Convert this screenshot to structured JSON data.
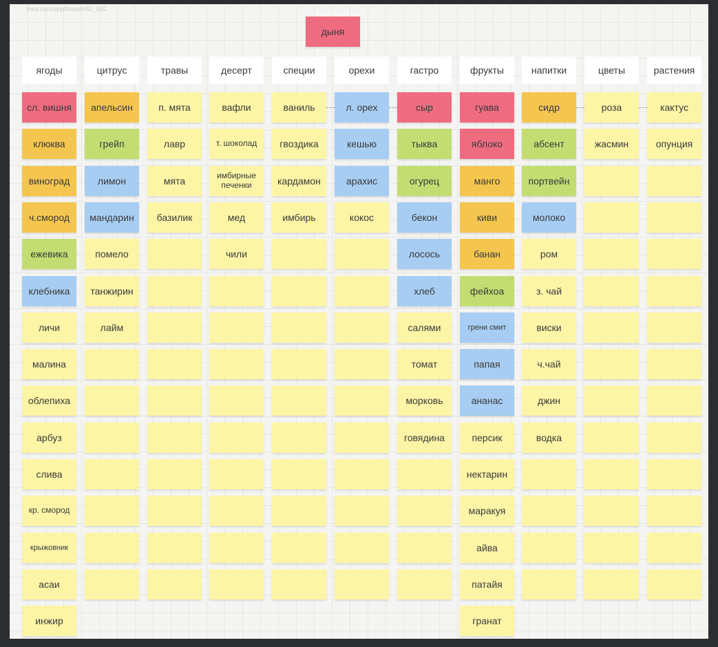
{
  "board": {
    "url_fragment": "miro.com/app/board/o9J_lSG"
  },
  "top_note": {
    "label": "дыня",
    "color": "red"
  },
  "colors": {
    "yellow": "#fdf5a6",
    "red": "#ef6b80",
    "orange": "#f4c64f",
    "green": "#c3dd72",
    "blue": "#a7cdf2"
  },
  "columns": [
    {
      "header": "ягоды",
      "notes": [
        {
          "text": "сл. вишня",
          "color": "red"
        },
        {
          "text": "клюква",
          "color": "orange"
        },
        {
          "text": "виноград",
          "color": "orange"
        },
        {
          "text": "ч.смород",
          "color": "orange"
        },
        {
          "text": "ежевика",
          "color": "green"
        },
        {
          "text": "клебника",
          "color": "blue"
        },
        {
          "text": "личи",
          "color": "yellow"
        },
        {
          "text": "малина",
          "color": "yellow"
        },
        {
          "text": "облепиха",
          "color": "yellow"
        },
        {
          "text": "арбуз",
          "color": "yellow"
        },
        {
          "text": "слива",
          "color": "yellow"
        },
        {
          "text": "кр. смород",
          "color": "yellow",
          "size": "small"
        },
        {
          "text": "крыжовник",
          "color": "yellow",
          "size": "tiny"
        },
        {
          "text": "асаи",
          "color": "yellow"
        },
        {
          "text": "инжир",
          "color": "yellow"
        }
      ]
    },
    {
      "header": "цитрус",
      "notes": [
        {
          "text": "апельсин",
          "color": "orange"
        },
        {
          "text": "грейп",
          "color": "green"
        },
        {
          "text": "лимон",
          "color": "blue"
        },
        {
          "text": "мандарин",
          "color": "blue"
        },
        {
          "text": "помело",
          "color": "yellow"
        },
        {
          "text": "танжирин",
          "color": "yellow"
        },
        {
          "text": "лайм",
          "color": "yellow"
        },
        {
          "text": "",
          "color": "yellow"
        },
        {
          "text": "",
          "color": "yellow"
        },
        {
          "text": "",
          "color": "yellow"
        },
        {
          "text": "",
          "color": "yellow"
        },
        {
          "text": "",
          "color": "yellow"
        },
        {
          "text": "",
          "color": "yellow"
        },
        {
          "text": "",
          "color": "yellow"
        }
      ]
    },
    {
      "header": "травы",
      "notes": [
        {
          "text": "п. мята",
          "color": "yellow"
        },
        {
          "text": "лавр",
          "color": "yellow"
        },
        {
          "text": "мята",
          "color": "yellow"
        },
        {
          "text": "базилик",
          "color": "yellow"
        },
        {
          "text": "",
          "color": "yellow"
        },
        {
          "text": "",
          "color": "yellow"
        },
        {
          "text": "",
          "color": "yellow"
        },
        {
          "text": "",
          "color": "yellow"
        },
        {
          "text": "",
          "color": "yellow"
        },
        {
          "text": "",
          "color": "yellow"
        },
        {
          "text": "",
          "color": "yellow"
        },
        {
          "text": "",
          "color": "yellow"
        },
        {
          "text": "",
          "color": "yellow"
        },
        {
          "text": "",
          "color": "yellow"
        }
      ]
    },
    {
      "header": "десерт",
      "notes": [
        {
          "text": "вафли",
          "color": "yellow"
        },
        {
          "text": "т. шоколад",
          "color": "yellow",
          "size": "small"
        },
        {
          "text": "имбирные печенки",
          "color": "yellow",
          "size": "small"
        },
        {
          "text": "мед",
          "color": "yellow"
        },
        {
          "text": "чили",
          "color": "yellow"
        },
        {
          "text": "",
          "color": "yellow"
        },
        {
          "text": "",
          "color": "yellow"
        },
        {
          "text": "",
          "color": "yellow"
        },
        {
          "text": "",
          "color": "yellow"
        },
        {
          "text": "",
          "color": "yellow"
        },
        {
          "text": "",
          "color": "yellow"
        },
        {
          "text": "",
          "color": "yellow"
        },
        {
          "text": "",
          "color": "yellow"
        },
        {
          "text": "",
          "color": "yellow"
        }
      ]
    },
    {
      "header": "специи",
      "notes": [
        {
          "text": "ваниль",
          "color": "yellow"
        },
        {
          "text": "гвоздика",
          "color": "yellow"
        },
        {
          "text": "кардамон",
          "color": "yellow"
        },
        {
          "text": "имбирь",
          "color": "yellow"
        },
        {
          "text": "",
          "color": "yellow"
        },
        {
          "text": "",
          "color": "yellow"
        },
        {
          "text": "",
          "color": "yellow"
        },
        {
          "text": "",
          "color": "yellow"
        },
        {
          "text": "",
          "color": "yellow"
        },
        {
          "text": "",
          "color": "yellow"
        },
        {
          "text": "",
          "color": "yellow"
        },
        {
          "text": "",
          "color": "yellow"
        },
        {
          "text": "",
          "color": "yellow"
        },
        {
          "text": "",
          "color": "yellow"
        }
      ]
    },
    {
      "header": "орехи",
      "notes": [
        {
          "text": "л. орех",
          "color": "blue"
        },
        {
          "text": "кешью",
          "color": "blue"
        },
        {
          "text": "арахис",
          "color": "blue"
        },
        {
          "text": "кокос",
          "color": "yellow"
        },
        {
          "text": "",
          "color": "yellow"
        },
        {
          "text": "",
          "color": "yellow"
        },
        {
          "text": "",
          "color": "yellow"
        },
        {
          "text": "",
          "color": "yellow"
        },
        {
          "text": "",
          "color": "yellow"
        },
        {
          "text": "",
          "color": "yellow"
        },
        {
          "text": "",
          "color": "yellow"
        },
        {
          "text": "",
          "color": "yellow"
        },
        {
          "text": "",
          "color": "yellow"
        },
        {
          "text": "",
          "color": "yellow"
        }
      ]
    },
    {
      "header": "гастро",
      "notes": [
        {
          "text": "сыр",
          "color": "red"
        },
        {
          "text": "тыква",
          "color": "green"
        },
        {
          "text": "огурец",
          "color": "green"
        },
        {
          "text": "бекон",
          "color": "blue"
        },
        {
          "text": "лосось",
          "color": "blue"
        },
        {
          "text": "хлеб",
          "color": "blue"
        },
        {
          "text": "салями",
          "color": "yellow"
        },
        {
          "text": "томат",
          "color": "yellow"
        },
        {
          "text": "морковь",
          "color": "yellow"
        },
        {
          "text": "говядина",
          "color": "yellow"
        },
        {
          "text": "",
          "color": "yellow"
        },
        {
          "text": "",
          "color": "yellow"
        },
        {
          "text": "",
          "color": "yellow"
        },
        {
          "text": "",
          "color": "yellow"
        }
      ]
    },
    {
      "header": "фрукты",
      "notes": [
        {
          "text": "гуава",
          "color": "red"
        },
        {
          "text": "яблоко",
          "color": "red"
        },
        {
          "text": "манго",
          "color": "orange"
        },
        {
          "text": "киви",
          "color": "orange"
        },
        {
          "text": "банан",
          "color": "orange"
        },
        {
          "text": "фейхоа",
          "color": "green"
        },
        {
          "text": "грени смит",
          "color": "blue",
          "size": "tiny"
        },
        {
          "text": "папая",
          "color": "blue"
        },
        {
          "text": "ананас",
          "color": "blue"
        },
        {
          "text": "персик",
          "color": "yellow"
        },
        {
          "text": "нектарин",
          "color": "yellow"
        },
        {
          "text": "маракуя",
          "color": "yellow"
        },
        {
          "text": "айва",
          "color": "yellow"
        },
        {
          "text": "патайя",
          "color": "yellow"
        },
        {
          "text": "гранат",
          "color": "yellow"
        }
      ]
    },
    {
      "header": "напитки",
      "notes": [
        {
          "text": "сидр",
          "color": "orange"
        },
        {
          "text": "абсент",
          "color": "green"
        },
        {
          "text": "портвейн",
          "color": "green"
        },
        {
          "text": "молоко",
          "color": "blue"
        },
        {
          "text": "ром",
          "color": "yellow"
        },
        {
          "text": "з. чай",
          "color": "yellow"
        },
        {
          "text": "виски",
          "color": "yellow"
        },
        {
          "text": "ч.чай",
          "color": "yellow"
        },
        {
          "text": "джин",
          "color": "yellow"
        },
        {
          "text": "водка",
          "color": "yellow"
        },
        {
          "text": "",
          "color": "yellow"
        },
        {
          "text": "",
          "color": "yellow"
        },
        {
          "text": "",
          "color": "yellow"
        },
        {
          "text": "",
          "color": "yellow"
        }
      ]
    },
    {
      "header": "цветы",
      "notes": [
        {
          "text": "роза",
          "color": "yellow"
        },
        {
          "text": "жасмин",
          "color": "yellow"
        },
        {
          "text": "",
          "color": "yellow"
        },
        {
          "text": "",
          "color": "yellow"
        },
        {
          "text": "",
          "color": "yellow"
        },
        {
          "text": "",
          "color": "yellow"
        },
        {
          "text": "",
          "color": "yellow"
        },
        {
          "text": "",
          "color": "yellow"
        },
        {
          "text": "",
          "color": "yellow"
        },
        {
          "text": "",
          "color": "yellow"
        },
        {
          "text": "",
          "color": "yellow"
        },
        {
          "text": "",
          "color": "yellow"
        },
        {
          "text": "",
          "color": "yellow"
        },
        {
          "text": "",
          "color": "yellow"
        }
      ]
    },
    {
      "header": "растения",
      "notes": [
        {
          "text": "кактус",
          "color": "yellow"
        },
        {
          "text": "опунция",
          "color": "yellow"
        },
        {
          "text": "",
          "color": "yellow"
        },
        {
          "text": "",
          "color": "yellow"
        },
        {
          "text": "",
          "color": "yellow"
        },
        {
          "text": "",
          "color": "yellow"
        },
        {
          "text": "",
          "color": "yellow"
        },
        {
          "text": "",
          "color": "yellow"
        },
        {
          "text": "",
          "color": "yellow"
        },
        {
          "text": "",
          "color": "yellow"
        },
        {
          "text": "",
          "color": "yellow"
        },
        {
          "text": "",
          "color": "yellow"
        },
        {
          "text": "",
          "color": "yellow"
        },
        {
          "text": "",
          "color": "yellow"
        }
      ]
    }
  ]
}
